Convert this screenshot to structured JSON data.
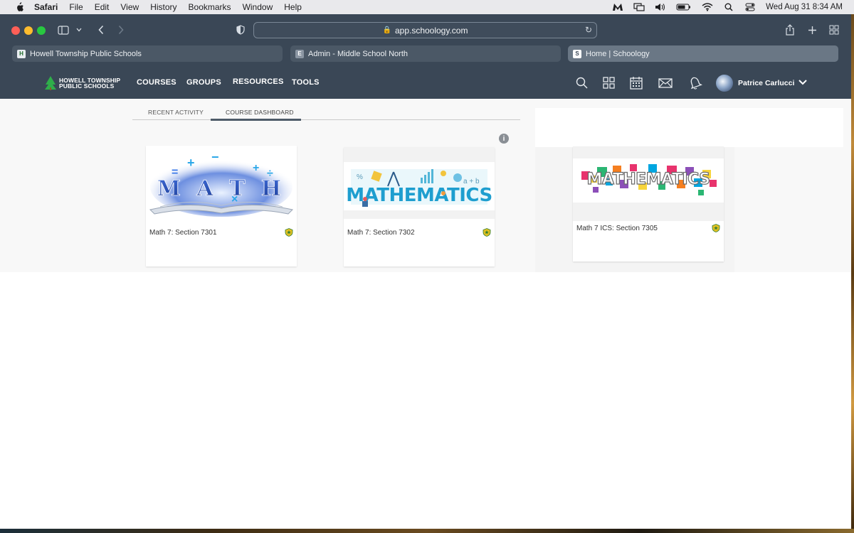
{
  "menubar": {
    "app": "Safari",
    "items": [
      "File",
      "Edit",
      "View",
      "History",
      "Bookmarks",
      "Window",
      "Help"
    ],
    "datetime": "Wed Aug 31  8:34 AM"
  },
  "browser": {
    "url": "app.schoology.com",
    "tabs": [
      {
        "label": "Howell Township Public Schools",
        "favicon": "H"
      },
      {
        "label": "Admin - Middle School North",
        "favicon": "E"
      },
      {
        "label": "Home | Schoology",
        "favicon": "S"
      }
    ]
  },
  "site": {
    "logo_line1": "HOWELL TOWNSHIP",
    "logo_line2": "PUBLIC SCHOOLS",
    "nav": [
      "COURSES",
      "GROUPS",
      "RESOURCES",
      "TOOLS"
    ],
    "user": "Patrice Carlucci"
  },
  "dashboard": {
    "tabs": [
      "RECENT ACTIVITY",
      "COURSE DASHBOARD"
    ],
    "active_tab": "COURSE DASHBOARD",
    "courses": [
      {
        "title": "Math 7: Section 7301",
        "image_text": "MATH"
      },
      {
        "title": "Math 7: Section 7302",
        "image_text": "MATHEMATICS"
      },
      {
        "title": "Math 7 ICS: Section 7305",
        "image_text": "MATHEMATICS"
      }
    ]
  },
  "colors": {
    "chrome": "#3a4756",
    "nav_bg": "#3a4756",
    "accent_underline": "#4e5b69"
  }
}
